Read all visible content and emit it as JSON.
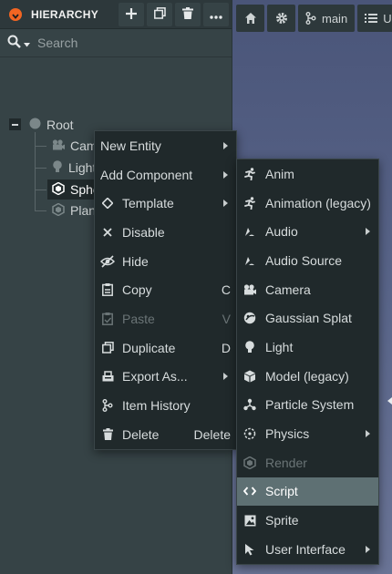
{
  "hierarchy": {
    "title": "HIERARCHY",
    "search": {
      "placeholder": "Search",
      "value": ""
    },
    "tree": {
      "root": "Root",
      "children": [
        {
          "label": "Camera",
          "icon": "camera-icon"
        },
        {
          "label": "Light",
          "icon": "light-icon"
        },
        {
          "label": "Sphere",
          "icon": "model-icon",
          "selected": true
        },
        {
          "label": "Plane",
          "icon": "model-icon"
        }
      ]
    }
  },
  "viewport_toolbar": {
    "branch_label": "main",
    "partial_label": "U"
  },
  "context_menu": {
    "items": [
      {
        "label": "New Entity",
        "submenu": true
      },
      {
        "label": "Add Component",
        "submenu": true,
        "active": true
      },
      {
        "label": "Template",
        "icon": "template-icon",
        "submenu": true
      },
      {
        "label": "Disable",
        "icon": "close-icon"
      },
      {
        "label": "Hide",
        "icon": "eye-slash-icon"
      },
      {
        "label": "Copy",
        "icon": "copy-icon",
        "shortcut": "C"
      },
      {
        "label": "Paste",
        "icon": "paste-icon",
        "shortcut": "V",
        "disabled": true
      },
      {
        "label": "Duplicate",
        "icon": "duplicate-icon",
        "shortcut": "D"
      },
      {
        "label": "Export As...",
        "icon": "export-icon",
        "submenu": true
      },
      {
        "label": "Item History",
        "icon": "history-icon"
      },
      {
        "label": "Delete",
        "icon": "trash-icon",
        "shortcut": "Delete"
      }
    ]
  },
  "component_menu": {
    "items": [
      {
        "label": "Anim",
        "icon": "anim-icon"
      },
      {
        "label": "Animation (legacy)",
        "icon": "animation-icon"
      },
      {
        "label": "Audio",
        "icon": "audio-icon",
        "submenu": true
      },
      {
        "label": "Audio Source",
        "icon": "audio-source-icon"
      },
      {
        "label": "Camera",
        "icon": "camera-icon"
      },
      {
        "label": "Gaussian Splat",
        "icon": "gaussian-splat-icon"
      },
      {
        "label": "Light",
        "icon": "light-icon"
      },
      {
        "label": "Model (legacy)",
        "icon": "model-cube-icon"
      },
      {
        "label": "Particle System",
        "icon": "particle-system-icon"
      },
      {
        "label": "Physics",
        "icon": "physics-icon",
        "submenu": true
      },
      {
        "label": "Render",
        "icon": "render-icon",
        "disabled": true
      },
      {
        "label": "Script",
        "icon": "script-icon",
        "highlighted": true
      },
      {
        "label": "Sprite",
        "icon": "sprite-icon"
      },
      {
        "label": "User Interface",
        "icon": "user-interface-icon",
        "submenu": true
      }
    ]
  },
  "colors": {
    "accent": "#f26522",
    "panel_bg": "#364346",
    "menu_bg": "#20292b",
    "highlight": "#5e7073"
  }
}
